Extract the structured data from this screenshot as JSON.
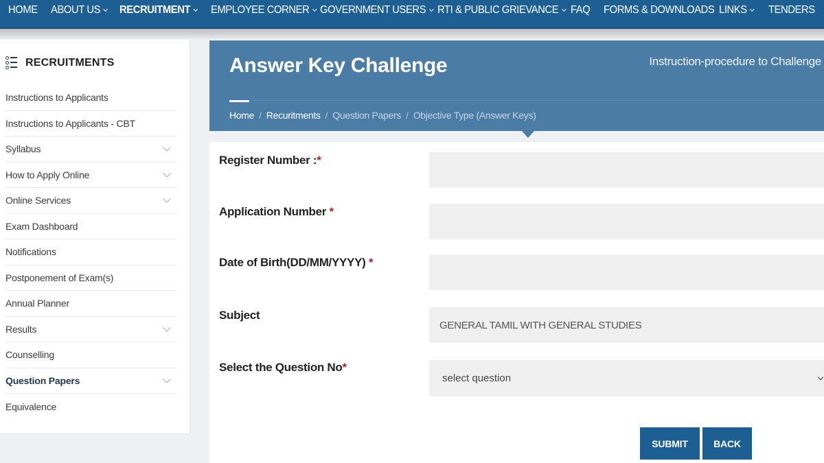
{
  "topnav": {
    "items": [
      {
        "label": "HOME",
        "dropdown": false,
        "active": false
      },
      {
        "label": "ABOUT US",
        "dropdown": true,
        "active": false
      },
      {
        "label": "RECRUITMENT",
        "dropdown": true,
        "active": true
      },
      {
        "label": "EMPLOYEE CORNER",
        "dropdown": true,
        "active": false
      },
      {
        "label": "GOVERNMENT USERS",
        "dropdown": true,
        "active": false
      },
      {
        "label": "RTI & PUBLIC GRIEVANCE",
        "dropdown": true,
        "active": false
      },
      {
        "label": "FAQ",
        "dropdown": false,
        "active": false
      },
      {
        "label": "FORMS & DOWNLOADS",
        "dropdown": false,
        "active": false
      },
      {
        "label": "LINKS",
        "dropdown": true,
        "active": false
      },
      {
        "label": "TENDERS",
        "dropdown": false,
        "active": false
      }
    ]
  },
  "sidebar": {
    "title": "RECRUITMENTS",
    "icon": "list-icon",
    "items": [
      {
        "label": "Instructions to Applicants",
        "expandable": false,
        "active": false
      },
      {
        "label": "Instructions to Applicants - CBT",
        "expandable": false,
        "active": false
      },
      {
        "label": "Syllabus",
        "expandable": true,
        "active": false
      },
      {
        "label": "How to Apply Online",
        "expandable": true,
        "active": false
      },
      {
        "label": "Online Services",
        "expandable": true,
        "active": false
      },
      {
        "label": "Exam Dashboard",
        "expandable": false,
        "active": false
      },
      {
        "label": "Notifications",
        "expandable": false,
        "active": false
      },
      {
        "label": "Postponement of Exam(s)",
        "expandable": false,
        "active": false
      },
      {
        "label": "Annual Planner",
        "expandable": false,
        "active": false
      },
      {
        "label": "Results",
        "expandable": true,
        "active": false
      },
      {
        "label": "Counselling",
        "expandable": false,
        "active": false
      },
      {
        "label": "Question Papers",
        "expandable": true,
        "active": true
      },
      {
        "label": "Equivalence",
        "expandable": false,
        "active": false
      }
    ]
  },
  "banner": {
    "title": "Answer Key Challenge",
    "instruction_link": "Instruction-procedure to Challenge",
    "breadcrumb": [
      {
        "label": "Home",
        "current": false
      },
      {
        "label": "Recuritments",
        "current": false
      },
      {
        "label": "Question Papers",
        "current": true
      },
      {
        "label": "Objective Type (Answer Keys)",
        "current": true
      }
    ],
    "separator": "/"
  },
  "form": {
    "register_number": {
      "label": "Register Number :",
      "required_mark": "*",
      "value": "",
      "placeholder": ""
    },
    "application_number": {
      "label": "Application Number ",
      "required_mark": "*",
      "value": "",
      "placeholder": ""
    },
    "dob": {
      "label": "Date of Birth(DD/MM/YYYY) ",
      "required_mark": "*",
      "value": "",
      "placeholder": ""
    },
    "subject": {
      "label": "Subject",
      "value": "GENERAL TAMIL WITH GENERAL STUDIES"
    },
    "question_no": {
      "label": "Select the Question No",
      "required_mark": "*",
      "selected": "select question"
    },
    "submit_label": "SUBMIT",
    "back_label": "BACK"
  },
  "colors": {
    "nav_bg": "#1d5f92",
    "banner_bg": "#4a7ca5",
    "button_bg": "#1d5f92",
    "required": "#a4262c",
    "input_bg": "#efefef"
  }
}
